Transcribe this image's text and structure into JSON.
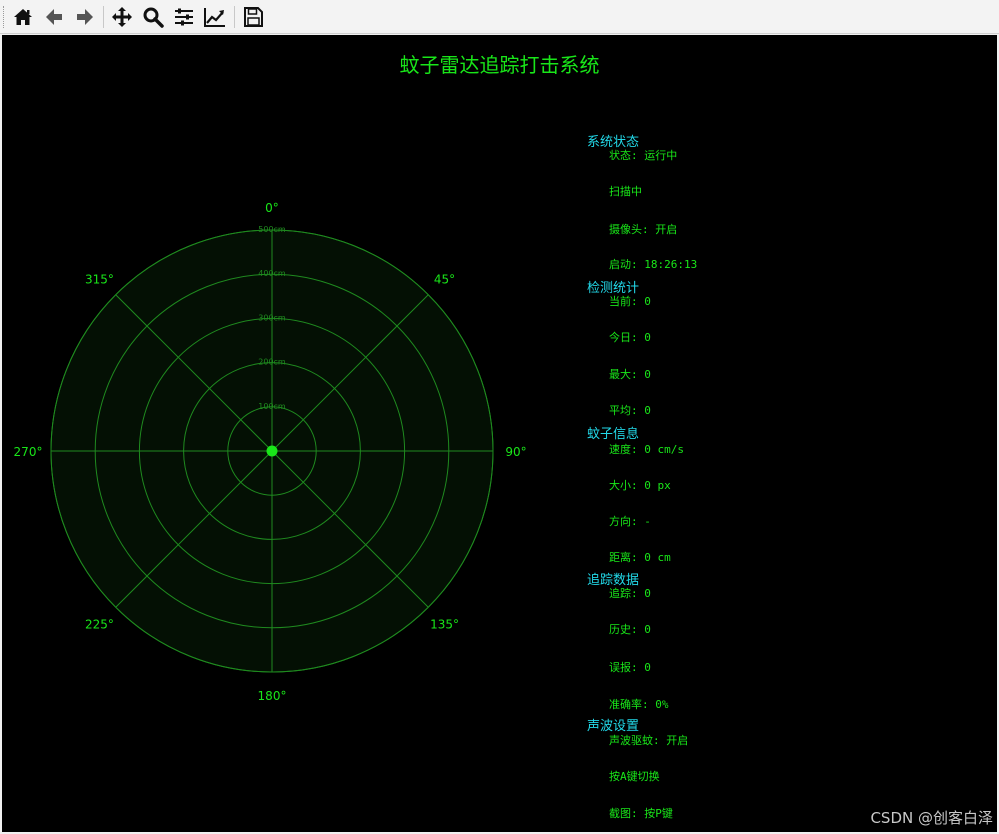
{
  "toolbar": {
    "buttons": [
      "home-icon",
      "back-arrow-icon",
      "forward-arrow-icon",
      "pan-icon",
      "zoom-icon",
      "configure-subplots-icon",
      "edit-axis-icon",
      "save-icon"
    ]
  },
  "figure": {
    "title": "蚊子雷达追踪打击系统"
  },
  "radar": {
    "range_labels": [
      "100cm",
      "200cm",
      "300cm",
      "400cm",
      "500cm"
    ],
    "angle_labels": {
      "a0": "0°",
      "a45": "45°",
      "a90": "90°",
      "a135": "135°",
      "a180": "180°",
      "a225": "225°",
      "a270": "270°",
      "a315": "315°"
    },
    "colors": {
      "background": "#000000",
      "disc": "#041004",
      "grid": "#1f8a1f",
      "text": "#19e619",
      "center_dot": "#19e619"
    }
  },
  "status": {
    "system": {
      "title": "系统状态",
      "items": [
        "状态: 运行中",
        "扫描中",
        "摄像头: 开启",
        "启动: 18:26:13"
      ]
    },
    "detection": {
      "title": "检测统计",
      "items": [
        "当前: 0",
        "今日: 0",
        "最大: 0",
        "平均: 0"
      ]
    },
    "mosquito": {
      "title": "蚊子信息",
      "items": [
        "速度: 0 cm/s",
        "大小: 0 px",
        "方向: -",
        "距离: 0 cm"
      ]
    },
    "tracking": {
      "title": "追踪数据",
      "items": [
        "追踪: 0",
        "历史: 0",
        "误报: 0",
        "准确率: 0%"
      ]
    },
    "sonic": {
      "title": "声波设置",
      "items": [
        "声波驱蚊: 开启",
        "按A键切换",
        "截图: 按P键"
      ]
    }
  },
  "watermark": "CSDN @创客白泽"
}
